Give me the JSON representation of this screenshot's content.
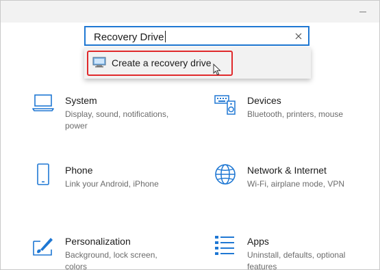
{
  "search": {
    "value": "Recovery Drive",
    "suggestion": "Create a recovery drive"
  },
  "tiles": [
    {
      "title": "System",
      "description": "Display, sound, notifications, power",
      "icon": "laptop-icon"
    },
    {
      "title": "Devices",
      "description": "Bluetooth, printers, mouse",
      "icon": "keyboard-speaker-icon"
    },
    {
      "title": "Phone",
      "description": "Link your Android, iPhone",
      "icon": "phone-icon"
    },
    {
      "title": "Network & Internet",
      "description": "Wi-Fi, airplane mode, VPN",
      "icon": "globe-icon"
    },
    {
      "title": "Personalization",
      "description": "Background, lock screen, colors",
      "icon": "paintbrush-icon"
    },
    {
      "title": "Apps",
      "description": "Uninstall, defaults, optional features",
      "icon": "apps-list-icon"
    }
  ],
  "colors": {
    "accent": "#1e77d3",
    "highlight": "#e0282a",
    "icon": "#1e77d3"
  }
}
